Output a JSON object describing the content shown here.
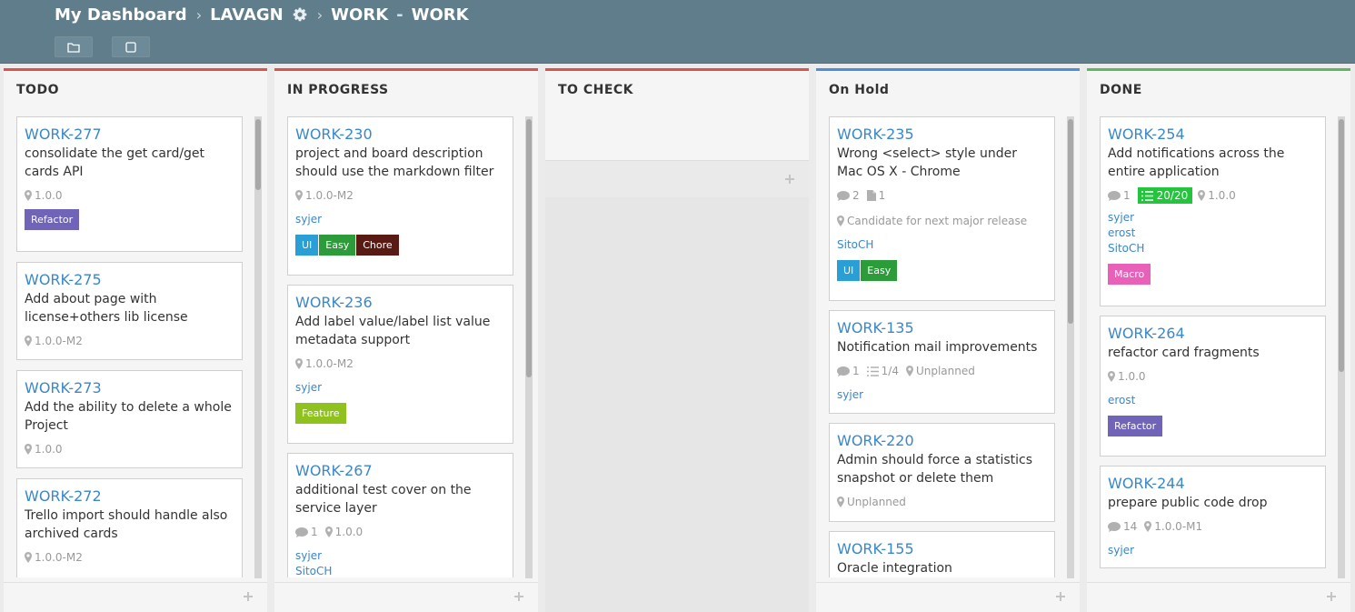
{
  "breadcrumb": {
    "dashboard": "My Dashboard",
    "project": "LAVAGN",
    "board_key": "WORK",
    "board_name": "WORK",
    "dash": "-"
  },
  "toolbar": {
    "folder_icon": "folder-icon",
    "square_icon": "square-icon"
  },
  "colors": {
    "topbar": "#607d8b",
    "link": "#3a87c9",
    "red": "#d9534f",
    "blue": "#4a90d9",
    "green": "#5cb85c"
  },
  "columns": [
    {
      "name": "TODO",
      "color": "#d9534f",
      "cards": [
        {
          "id": "WORK-277",
          "title": "consolidate the get card/get cards API",
          "milestone": "1.0.0",
          "labels": [
            {
              "text": "Refactor",
              "color": "#6f64b8"
            }
          ]
        },
        {
          "id": "WORK-275",
          "title": "Add about page with license+others lib license",
          "milestone": "1.0.0-M2"
        },
        {
          "id": "WORK-273",
          "title": "Add the ability to delete a whole Project",
          "milestone": "1.0.0"
        },
        {
          "id": "WORK-272",
          "title": "Trello import should handle also archived cards",
          "milestone": "1.0.0-M2"
        }
      ]
    },
    {
      "name": "IN PROGRESS",
      "color": "#d9534f",
      "cards": [
        {
          "id": "WORK-230",
          "title": "project and board description should use the markdown filter",
          "milestone": "1.0.0-M2",
          "users": [
            "syjer"
          ],
          "labels": [
            {
              "text": "UI",
              "color": "#2a9fd6"
            },
            {
              "text": "Easy",
              "color": "#2c9b3a"
            },
            {
              "text": "Chore",
              "color": "#5a1a14"
            }
          ]
        },
        {
          "id": "WORK-236",
          "title": "Add label value/label list value metadata support",
          "milestone": "1.0.0-M2",
          "users": [
            "syjer"
          ],
          "labels": [
            {
              "text": "Feature",
              "color": "#8fc21f"
            }
          ]
        },
        {
          "id": "WORK-267",
          "title": "additional test cover on the service layer",
          "comments": "1",
          "milestone": "1.0.0",
          "users": [
            "syjer",
            "SitoCH"
          ]
        }
      ]
    },
    {
      "name": "TO CHECK",
      "color": "#d9534f",
      "cards": []
    },
    {
      "name": "On Hold",
      "color": "#4a90d9",
      "cards": [
        {
          "id": "WORK-235",
          "title": "Wrong <select> style under Mac OS X - Chrome",
          "comments": "2",
          "files": "1",
          "milestone": "Candidate for next major release",
          "users": [
            "SitoCH"
          ],
          "labels": [
            {
              "text": "UI",
              "color": "#2a9fd6"
            },
            {
              "text": "Easy",
              "color": "#2c9b3a"
            }
          ]
        },
        {
          "id": "WORK-135",
          "title": "Notification mail improvements",
          "comments": "1",
          "checklist": "1/4",
          "milestone": "Unplanned",
          "users": [
            "syjer"
          ]
        },
        {
          "id": "WORK-220",
          "title": "Admin should force a statistics snapshot or delete them",
          "milestone": "Unplanned"
        },
        {
          "id": "WORK-155",
          "title": "Oracle integration"
        }
      ]
    },
    {
      "name": "DONE",
      "color": "#5cb85c",
      "cards": [
        {
          "id": "WORK-254",
          "title": "Add notifications across the entire application",
          "comments": "1",
          "checklist_done": "20/20",
          "milestone": "1.0.0",
          "users": [
            "syjer",
            "erost",
            "SitoCH"
          ],
          "labels": [
            {
              "text": "Macro",
              "color": "#e860b8"
            }
          ]
        },
        {
          "id": "WORK-264",
          "title": "refactor card fragments",
          "milestone": "1.0.0",
          "users": [
            "erost"
          ],
          "labels": [
            {
              "text": "Refactor",
              "color": "#6f64b8"
            }
          ]
        },
        {
          "id": "WORK-244",
          "title": "prepare public code drop",
          "comments": "14",
          "milestone": "1.0.0-M1",
          "users": [
            "syjer"
          ]
        }
      ]
    }
  ]
}
